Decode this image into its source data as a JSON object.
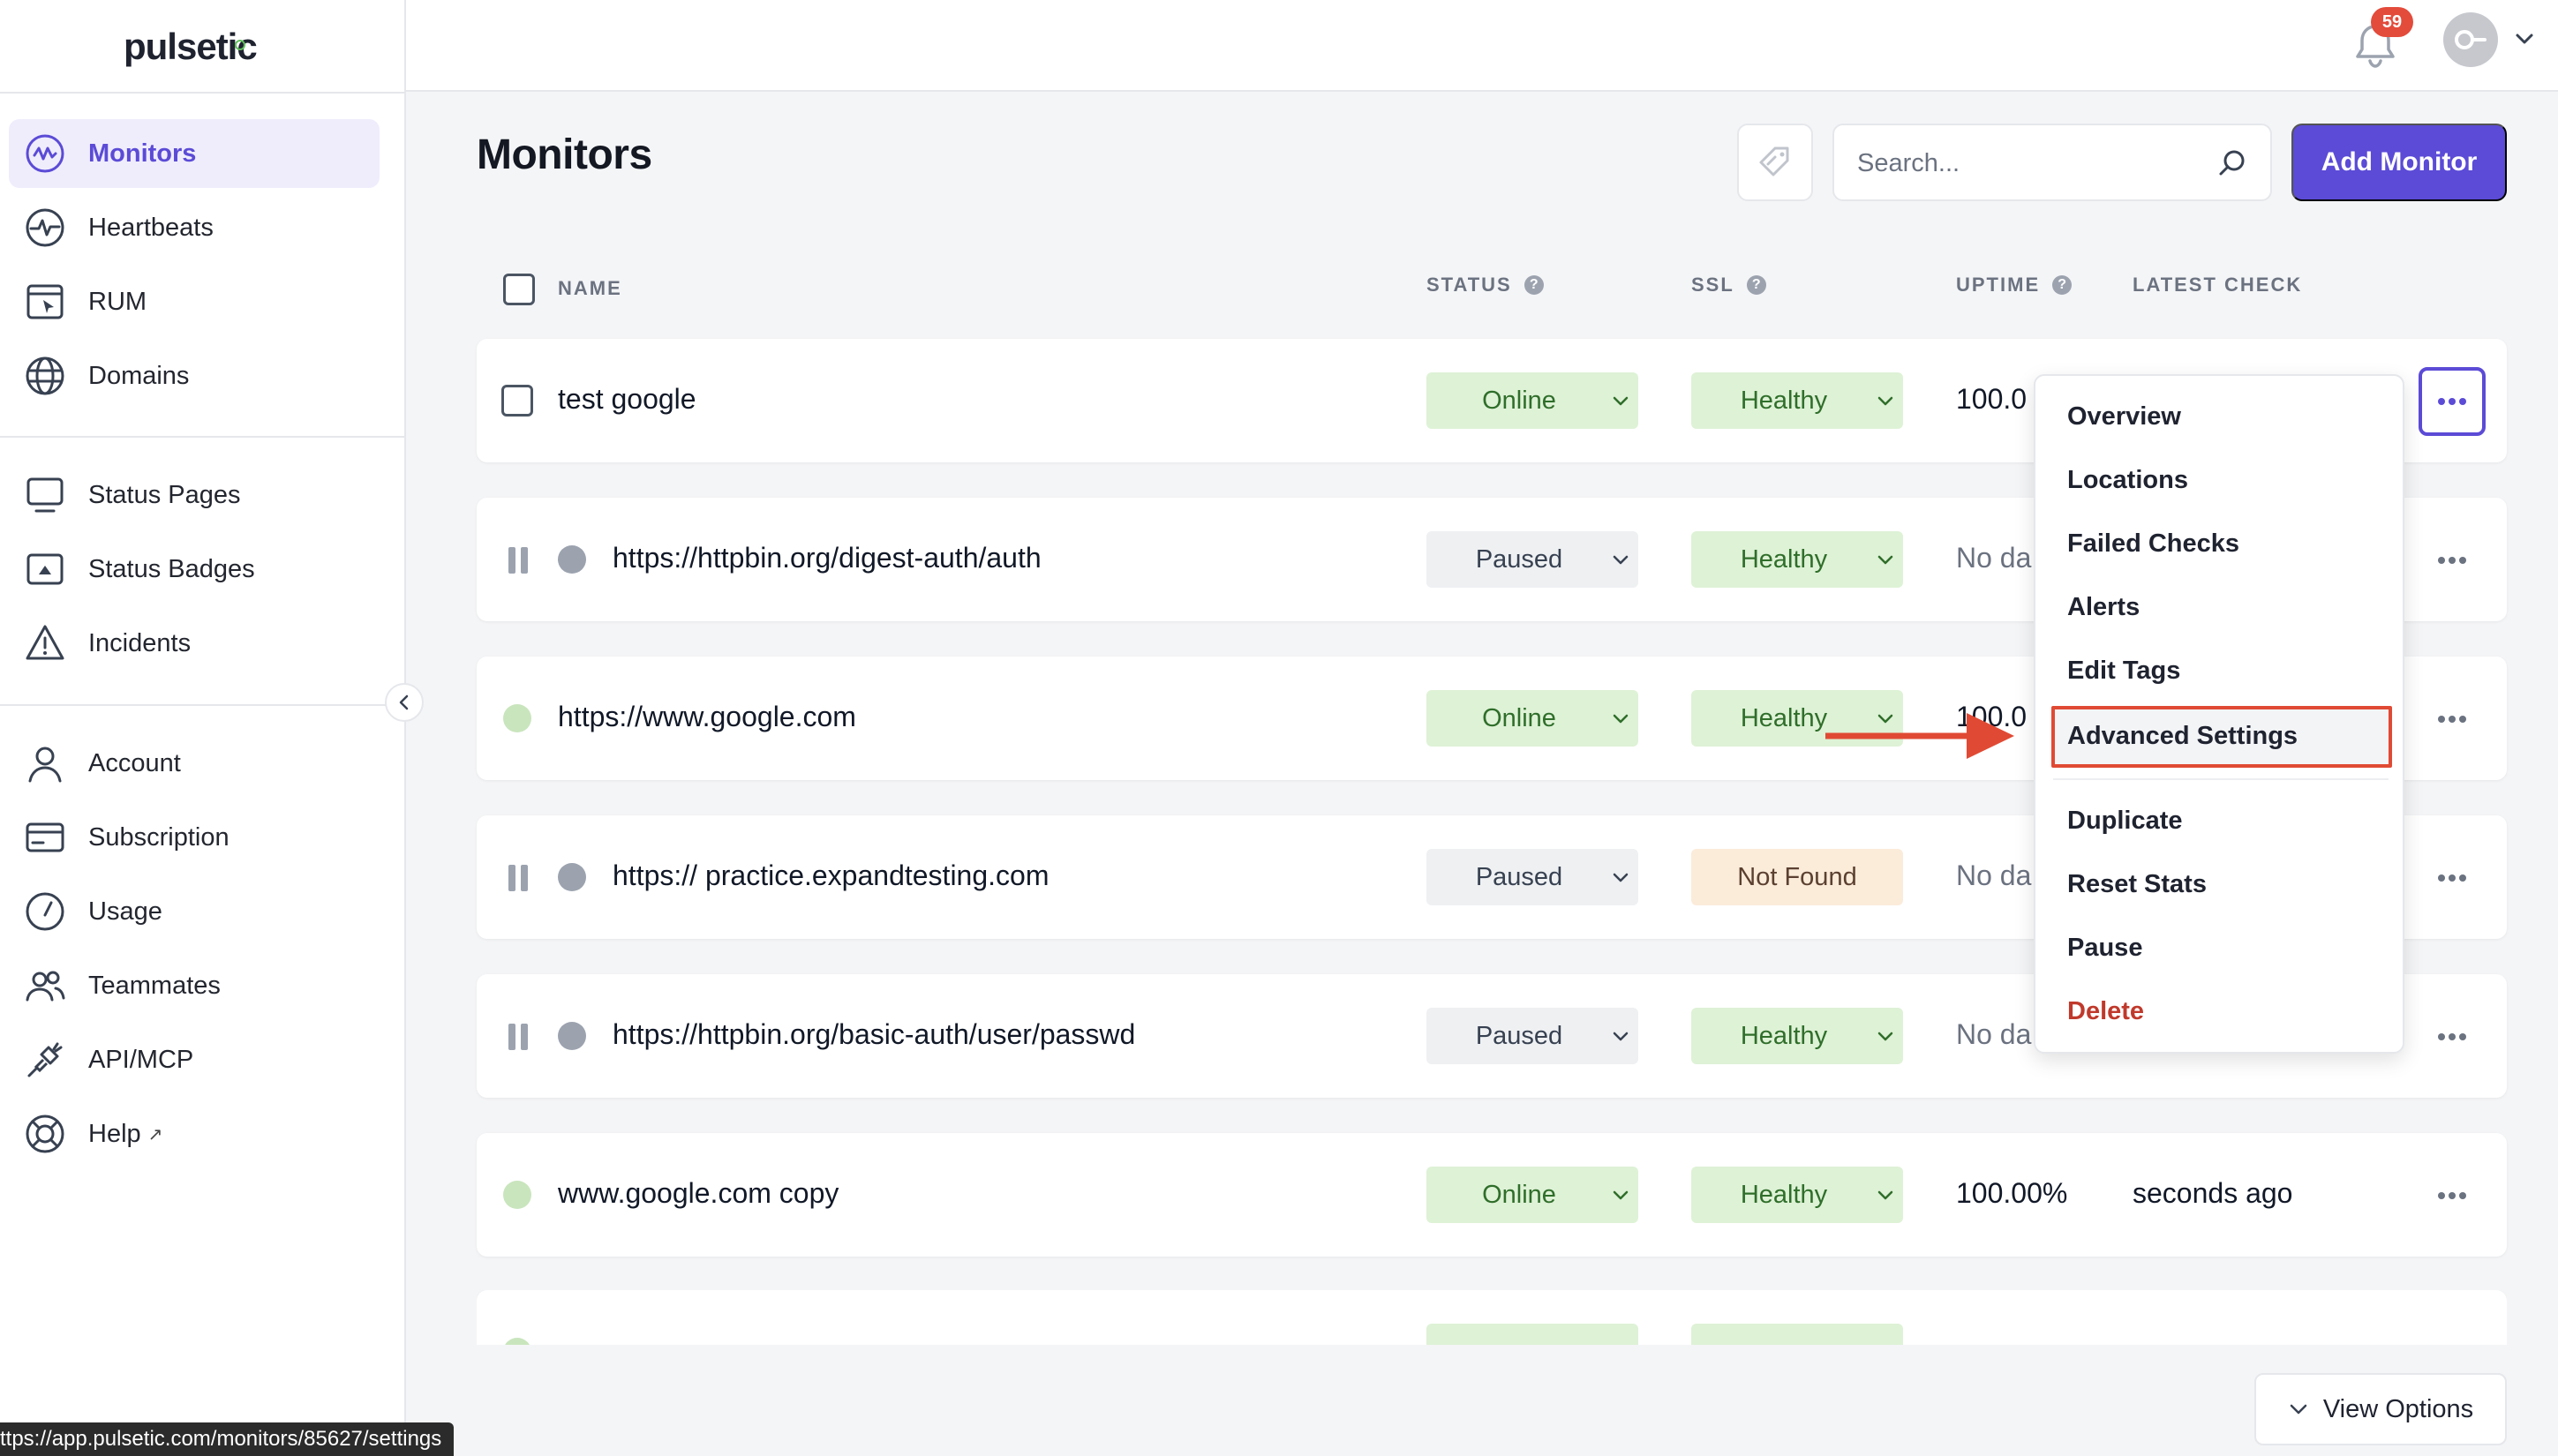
{
  "app": {
    "logo": "pulsetic"
  },
  "sidebar": {
    "group1": [
      {
        "label": "Monitors",
        "icon": "pulse-circle-icon",
        "active": true
      },
      {
        "label": "Heartbeats",
        "icon": "heartbeat-icon"
      },
      {
        "label": "RUM",
        "icon": "browser-cursor-icon"
      },
      {
        "label": "Domains",
        "icon": "globe-icon"
      }
    ],
    "group2": [
      {
        "label": "Status Pages",
        "icon": "monitor-icon"
      },
      {
        "label": "Status Badges",
        "icon": "badge-icon"
      },
      {
        "label": "Incidents",
        "icon": "warning-icon"
      }
    ],
    "group3": [
      {
        "label": "Account",
        "icon": "user-icon"
      },
      {
        "label": "Subscription",
        "icon": "card-icon"
      },
      {
        "label": "Usage",
        "icon": "gauge-icon"
      },
      {
        "label": "Teammates",
        "icon": "users-icon"
      },
      {
        "label": "API/MCP",
        "icon": "plug-icon"
      },
      {
        "label": "Help",
        "icon": "lifebuoy-icon",
        "external_mark": "↗"
      }
    ]
  },
  "topbar": {
    "notification_count": "59"
  },
  "main": {
    "title": "Monitors",
    "search_placeholder": "Search...",
    "add_button": "Add Monitor",
    "columns": {
      "name": "NAME",
      "status": "STATUS",
      "ssl": "SSL",
      "uptime": "UPTIME",
      "latest": "LATEST CHECK",
      "help": "?"
    },
    "rows": [
      {
        "name": "test google",
        "status": "Online",
        "ssl": "Healthy",
        "uptime": "100.0",
        "latest": ""
      },
      {
        "name": "https://httpbin.org/digest-auth/auth",
        "status": "Paused",
        "ssl": "Healthy",
        "uptime": "No da",
        "latest": ""
      },
      {
        "name": "https://www.google.com",
        "status": "Online",
        "ssl": "Healthy",
        "uptime": "100.0",
        "latest": ""
      },
      {
        "name": "https:// practice.expandtesting.com",
        "status": "Paused",
        "ssl": "Not Found",
        "uptime": "No da",
        "latest": ""
      },
      {
        "name": "https://httpbin.org/basic-auth/user/passwd",
        "status": "Paused",
        "ssl": "Healthy",
        "uptime": "No da",
        "latest": ""
      },
      {
        "name": "www.google.com copy",
        "status": "Online",
        "ssl": "Healthy",
        "uptime": "100.00%",
        "latest": "seconds ago"
      }
    ],
    "view_options": "View Options"
  },
  "menu": {
    "items": [
      "Overview",
      "Locations",
      "Failed Checks",
      "Alerts",
      "Edit Tags",
      "Advanced Settings",
      "Duplicate",
      "Reset Stats",
      "Pause",
      "Delete"
    ],
    "highlighted": "Advanced Settings"
  },
  "status_bar": {
    "url": "ttps://app.pulsetic.com/monitors/85627/settings"
  },
  "colors": {
    "accent": "#5b4bd6",
    "online_bg": "#def2d6",
    "paused_bg": "#eef0f2",
    "notfound_bg": "#fbebd9",
    "danger": "#c0392b",
    "annotation": "#e04a34"
  }
}
